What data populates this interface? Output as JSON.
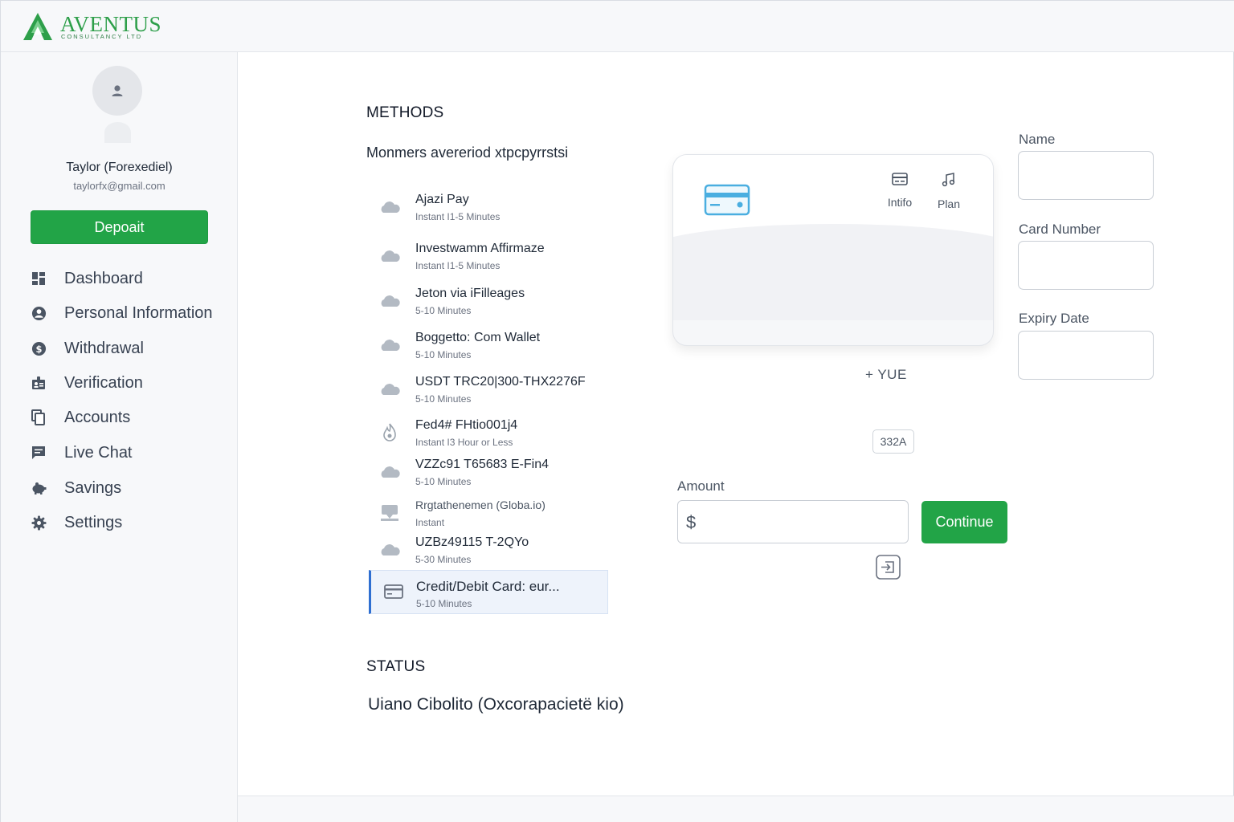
{
  "brand": {
    "name": "AVENTUS",
    "tagline": "CONSULTANCY LTD",
    "color": "#2e9f4a"
  },
  "user": {
    "name": "Taylor (Forexediel)",
    "email": "taylorfx@gmail.com"
  },
  "sidebar": {
    "deposit_label": "Depoait",
    "items": [
      {
        "label": "Dashboard",
        "icon": "dashboard-icon"
      },
      {
        "label": "Personal Information",
        "icon": "user-circle-icon"
      },
      {
        "label": "Withdrawal",
        "icon": "dollar-circle-icon"
      },
      {
        "label": "Verification",
        "icon": "badge-icon"
      },
      {
        "label": "Accounts",
        "icon": "copy-icon"
      },
      {
        "label": "Live Chat",
        "icon": "chat-icon"
      },
      {
        "label": "Savings",
        "icon": "piggy-bank-icon"
      },
      {
        "label": "Settings",
        "icon": "gear-icon"
      }
    ]
  },
  "methods": {
    "title": "METHODS",
    "subtitle": "Monmers avereriod xtpcpyrrstsi",
    "items": [
      {
        "name": "Ajazi Pay",
        "time": "Instant I1-5 Minutes",
        "icon": "cloud-icon"
      },
      {
        "name": "Investwamm Affirmaze",
        "time": "Instant I1-5 Minutes",
        "icon": "cloud-icon"
      },
      {
        "name": "Jeton via iFilleages",
        "time": "5-10 Minutes",
        "icon": "cloud-icon"
      },
      {
        "name": "Boggetto: Com Wallet",
        "time": "5-10 Minutes",
        "icon": "cloud-icon"
      },
      {
        "name": "USDT TRC20|300-THX2276F",
        "time": "5-10 Minutes",
        "icon": "cloud-icon"
      },
      {
        "name": "Fed4# FHtio001j4",
        "time": "Instant I3 Hour or Less",
        "icon": "flame-icon"
      },
      {
        "name": "VZZc91 T65683 E-Fin4",
        "time": "5-10 Minutes",
        "icon": "cloud-icon"
      },
      {
        "name": "Rrgtathenemen (Globa.io)",
        "time": "Instant",
        "icon": "bank-icon"
      },
      {
        "name": "UZBz49115 T-2QYo",
        "time": "5-30 Minutes",
        "icon": "cloud-icon"
      },
      {
        "name": "Credit/Debit Card: eur...",
        "time": "5-10 Minutes",
        "icon": "credit-card-icon",
        "selected": true
      }
    ]
  },
  "card_preview": {
    "actions": [
      {
        "label": "Intifo",
        "icon": "card-small-icon"
      },
      {
        "label": "Plan",
        "icon": "music-note-icon"
      }
    ],
    "add_label": "+  YUE",
    "code": "332A"
  },
  "amount": {
    "label": "Amount",
    "currency": "$",
    "value": "",
    "continue_label": "Continue"
  },
  "form": {
    "name_label": "Name",
    "card_number_label": "Card Number",
    "expiry_label": "Expiry Date"
  },
  "status": {
    "title": "STATUS",
    "text": "Uiano Cibolito (Oxcorapacietë kio)"
  },
  "colors": {
    "accent": "#22a447",
    "selected_border": "#2f6fd1",
    "icon_gray": "#9aa3ad"
  }
}
